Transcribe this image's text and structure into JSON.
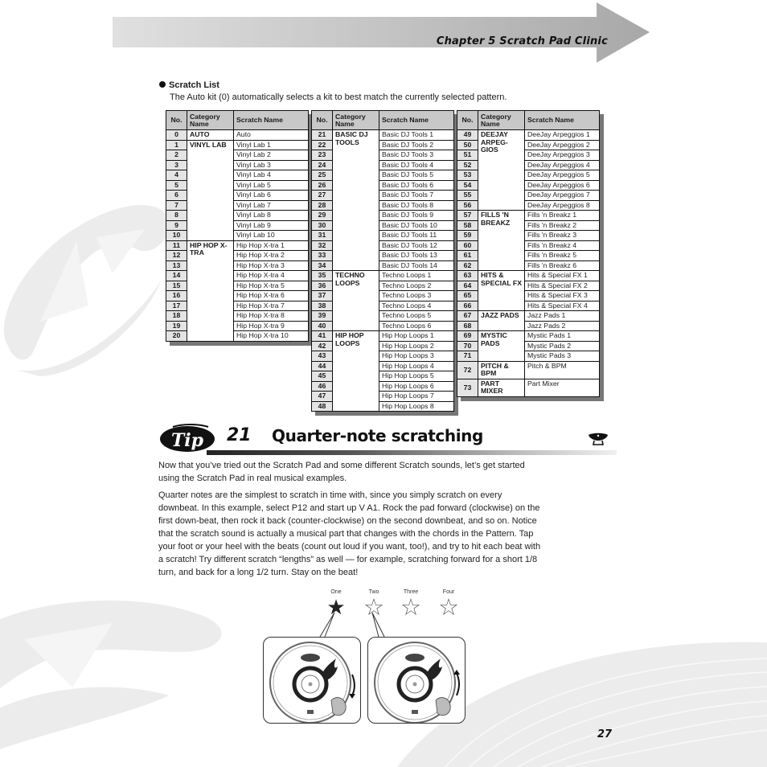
{
  "header": {
    "chapter_title": "Chapter 5 Scratch Pad Clinic"
  },
  "scratch_list": {
    "heading": "Scratch List",
    "description": "The Auto kit (0) automatically selects a kit to best match the currently selected pattern.",
    "columns": [
      "No.",
      "Category Name",
      "Scratch Name"
    ],
    "tables": [
      {
        "groups": [
          {
            "category": "AUTO",
            "rows": [
              {
                "no": "0",
                "name": "Auto"
              }
            ]
          },
          {
            "category": "VINYL LAB",
            "rows": [
              {
                "no": "1",
                "name": "Vinyl Lab 1"
              },
              {
                "no": "2",
                "name": "Vinyl Lab 2"
              },
              {
                "no": "3",
                "name": "Vinyl Lab 3"
              },
              {
                "no": "4",
                "name": "Vinyl Lab 4"
              },
              {
                "no": "5",
                "name": "Vinyl Lab 5"
              },
              {
                "no": "6",
                "name": "Vinyl Lab 6"
              },
              {
                "no": "7",
                "name": "Vinyl Lab 7"
              },
              {
                "no": "8",
                "name": "Vinyl Lab 8"
              },
              {
                "no": "9",
                "name": "Vinyl Lab 9"
              },
              {
                "no": "10",
                "name": "Vinyl Lab 10"
              }
            ]
          },
          {
            "category": "HIP HOP X-TRA",
            "rows": [
              {
                "no": "11",
                "name": "Hip Hop X-tra 1"
              },
              {
                "no": "12",
                "name": "Hip Hop X-tra 2"
              },
              {
                "no": "13",
                "name": "Hip Hop X-tra 3"
              },
              {
                "no": "14",
                "name": "Hip Hop X-tra 4"
              },
              {
                "no": "15",
                "name": "Hip Hop X-tra 5"
              },
              {
                "no": "16",
                "name": "Hip Hop X-tra 6"
              },
              {
                "no": "17",
                "name": "Hip Hop X-tra 7"
              },
              {
                "no": "18",
                "name": "Hip Hop X-tra 8"
              },
              {
                "no": "19",
                "name": "Hip Hop X-tra 9"
              },
              {
                "no": "20",
                "name": "Hip Hop X-tra 10"
              }
            ]
          }
        ]
      },
      {
        "groups": [
          {
            "category": "BASIC DJ TOOLS",
            "rows": [
              {
                "no": "21",
                "name": "Basic DJ Tools 1"
              },
              {
                "no": "22",
                "name": "Basic DJ Tools 2"
              },
              {
                "no": "23",
                "name": "Basic DJ Tools 3"
              },
              {
                "no": "24",
                "name": "Basic DJ Tools 4"
              },
              {
                "no": "25",
                "name": "Basic DJ Tools 5"
              },
              {
                "no": "26",
                "name": "Basic DJ Tools 6"
              },
              {
                "no": "27",
                "name": "Basic DJ Tools 7"
              },
              {
                "no": "28",
                "name": "Basic DJ Tools 8"
              },
              {
                "no": "29",
                "name": "Basic DJ Tools 9"
              },
              {
                "no": "30",
                "name": "Basic DJ Tools 10"
              },
              {
                "no": "31",
                "name": "Basic DJ Tools 11"
              },
              {
                "no": "32",
                "name": "Basic DJ Tools 12"
              },
              {
                "no": "33",
                "name": "Basic DJ Tools 13"
              },
              {
                "no": "34",
                "name": "Basic DJ Tools 14"
              }
            ]
          },
          {
            "category": "TECHNO LOOPS",
            "rows": [
              {
                "no": "35",
                "name": "Techno Loops 1"
              },
              {
                "no": "36",
                "name": "Techno Loops 2"
              },
              {
                "no": "37",
                "name": "Techno Loops 3"
              },
              {
                "no": "38",
                "name": "Techno Loops 4"
              },
              {
                "no": "39",
                "name": "Techno Loops 5"
              },
              {
                "no": "40",
                "name": "Techno Loops 6"
              }
            ]
          },
          {
            "category": "HIP HOP LOOPS",
            "rows": [
              {
                "no": "41",
                "name": "Hip Hop Loops 1"
              },
              {
                "no": "42",
                "name": "Hip Hop Loops 2"
              },
              {
                "no": "43",
                "name": "Hip Hop Loops 3"
              },
              {
                "no": "44",
                "name": "Hip Hop Loops 4"
              },
              {
                "no": "45",
                "name": "Hip Hop Loops 5"
              },
              {
                "no": "46",
                "name": "Hip Hop Loops 6"
              },
              {
                "no": "47",
                "name": "Hip Hop Loops 7"
              },
              {
                "no": "48",
                "name": "Hip Hop Loops 8"
              }
            ]
          }
        ]
      },
      {
        "groups": [
          {
            "category": "DEEJAY ARPEG-GIOS",
            "rows": [
              {
                "no": "49",
                "name": "DeeJay Arpeggios 1"
              },
              {
                "no": "50",
                "name": "DeeJay Arpeggios 2"
              },
              {
                "no": "51",
                "name": "DeeJay Arpeggios 3"
              },
              {
                "no": "52",
                "name": "DeeJay Arpeggios 4"
              },
              {
                "no": "53",
                "name": "DeeJay Arpeggios 5"
              },
              {
                "no": "54",
                "name": "DeeJay Arpeggios 6"
              },
              {
                "no": "55",
                "name": "DeeJay Arpeggios 7"
              },
              {
                "no": "56",
                "name": "DeeJay Arpeggios 8"
              }
            ]
          },
          {
            "category": "FILLS 'N BREAKZ",
            "rows": [
              {
                "no": "57",
                "name": "Fills 'n Breakz 1"
              },
              {
                "no": "58",
                "name": "Fills 'n Breakz 2"
              },
              {
                "no": "59",
                "name": "Fills 'n Breakz 3"
              },
              {
                "no": "60",
                "name": "Fills 'n Breakz 4"
              },
              {
                "no": "61",
                "name": "Fills 'n Breakz 5"
              },
              {
                "no": "62",
                "name": "Fills 'n Breakz 6"
              }
            ]
          },
          {
            "category": "HITS & SPECIAL FX",
            "rows": [
              {
                "no": "63",
                "name": "Hits & Special FX 1"
              },
              {
                "no": "64",
                "name": "Hits & Special FX 2"
              },
              {
                "no": "65",
                "name": "Hits & Special FX 3"
              },
              {
                "no": "66",
                "name": "Hits & Special FX 4"
              }
            ]
          },
          {
            "category": "JAZZ PADS",
            "rows": [
              {
                "no": "67",
                "name": "Jazz Pads 1"
              },
              {
                "no": "68",
                "name": "Jazz Pads 2"
              }
            ]
          },
          {
            "category": "MYSTIC PADS",
            "rows": [
              {
                "no": "69",
                "name": "Mystic Pads 1"
              },
              {
                "no": "70",
                "name": "Mystic Pads 2"
              },
              {
                "no": "71",
                "name": "Mystic Pads 3"
              }
            ]
          },
          {
            "category": "PITCH & BPM",
            "tall": true,
            "rows": [
              {
                "no": "72",
                "name": "Pitch & BPM"
              }
            ]
          },
          {
            "category": "PART MIXER",
            "tall": true,
            "rows": [
              {
                "no": "73",
                "name": "Part Mixer"
              }
            ]
          }
        ]
      }
    ]
  },
  "tip": {
    "badge": "Tip",
    "number": "21",
    "title": "Quarter-note scratching",
    "paragraphs": [
      "Now that you’ve tried out the Scratch Pad and some different Scratch sounds, let’s get started using the Scratch Pad in real musical examples.",
      "Quarter notes are the simplest to scratch in time with, since you simply scratch on every downbeat. In this example, select P12 and start up V A1.  Rock the pad forward (clockwise) on the first down-beat, then rock it back (counter-clockwise) on the second downbeat, and so on.  Notice that the scratch sound is actually a musical part that changes with the chords in the Pattern.  Tap your foot or your heel with the beats (count out loud if you want, too!), and try to hit each beat with a scratch! Try different scratch “lengths” as well — for example, scratching forward for a short 1/8 turn, and back for a long 1/2 turn.  Stay on the beat!"
    ]
  },
  "illustration": {
    "beats": [
      {
        "label": "One",
        "active": true
      },
      {
        "label": "Two",
        "active": false
      },
      {
        "label": "Three",
        "active": false
      },
      {
        "label": "Four",
        "active": false
      }
    ],
    "pads": [
      {
        "direction": "clockwise"
      },
      {
        "direction": "counter-clockwise"
      }
    ]
  },
  "page_number": "27"
}
